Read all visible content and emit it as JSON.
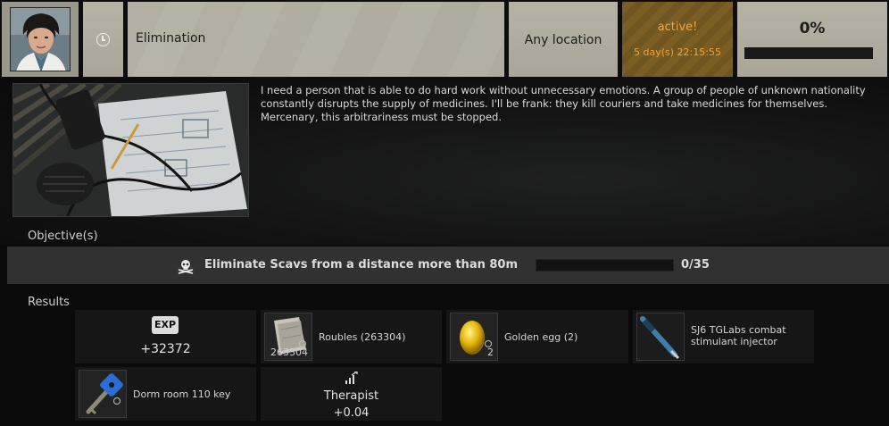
{
  "header": {
    "avatar": "trader-portrait",
    "timer_icon": "clock-icon",
    "quest_name": "Elimination",
    "location": "Any location",
    "status": "active!",
    "time_left": "5 day(s) 22:15:55",
    "progress_percent": "0%",
    "progress_fraction": 0
  },
  "description": {
    "image": "radio-and-notes-photo",
    "text": "I need a person that is able to do hard work without unnecessary emotions. A group of people of unknown nationality constantly disrupts the supply of medicines. I'll be frank: they kill couriers and take medicines for themselves. Mercenary, this arbitrariness must be stopped."
  },
  "objectives": {
    "title": "Objective(s)",
    "items": [
      {
        "icon": "skull-crossbones-icon",
        "text": "Eliminate Scavs from a distance more than 80m",
        "progress": "0/35",
        "progress_fraction": 0
      }
    ]
  },
  "results": {
    "title": "Results",
    "exp": {
      "badge": "EXP",
      "value": "+32372"
    },
    "items": [
      {
        "name": "Roubles (263304)",
        "qty": "263304",
        "icon": "roubles-stack-icon"
      },
      {
        "name": "Golden egg (2)",
        "qty": "2",
        "icon": "golden-egg-icon"
      },
      {
        "name": "SJ6 TGLabs combat stimulant injector",
        "qty": "",
        "icon": "injector-icon"
      },
      {
        "name": "Dorm room 110 key",
        "qty": "",
        "icon": "key-icon"
      }
    ],
    "standing": {
      "trader": "Therapist",
      "value": "+0.04",
      "icon": "standing-up-icon"
    }
  },
  "colors": {
    "header_cell": "#aeab9e",
    "active_text": "#f2a43a",
    "active_bg": "#735822",
    "objective_row": "#313131",
    "panel": "#161616"
  }
}
